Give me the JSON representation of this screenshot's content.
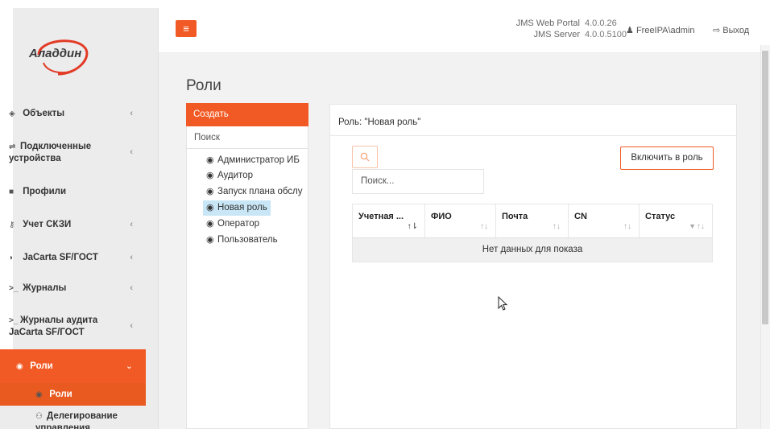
{
  "brand": {
    "logo_text": "Аладдин"
  },
  "topbar": {
    "portal_label": "JMS Web Portal",
    "portal_version": "4.0.0.26",
    "server_label": "JMS Server",
    "server_version": "4.0.0.5100",
    "user": "FreeIPA\\admin",
    "logout": "Выход"
  },
  "sidebar": {
    "items": [
      {
        "label": "Объекты",
        "icon": "diamond-icon"
      },
      {
        "label_line1": "Подключенные",
        "label_line2": "устройства",
        "icon": "usb-icon"
      },
      {
        "label": "Профили",
        "icon": "folder-icon"
      },
      {
        "label": "Учет СКЗИ",
        "icon": "key-icon"
      },
      {
        "label": "JaCarta SF/ГОСТ",
        "icon": "shield-icon"
      },
      {
        "label": "Журналы",
        "icon": "terminal-icon"
      },
      {
        "label_line1": "Журналы аудита",
        "label_line2": "JaCarta SF/ГОСТ",
        "icon": "terminal-icon"
      },
      {
        "label": "Роли",
        "icon": "user-circle-icon"
      },
      {
        "label": "Роли",
        "icon": "user-circle-icon"
      },
      {
        "label_line1": "Делегирование",
        "label_line2": "управления",
        "icon": "users-plus-icon"
      }
    ]
  },
  "page": {
    "title": "Роли"
  },
  "roles": {
    "create_label": "Создать",
    "search_label": "Поиск",
    "items": [
      "Администратор ИБ",
      "Аудитор",
      "Запуск плана обслу",
      "Новая роль",
      "Оператор",
      "Пользователь"
    ],
    "selected": "Новая роль"
  },
  "main": {
    "header": "Роль: \"Новая роль\"",
    "include_button": "Включить в роль",
    "search_placeholder": "Поиск...",
    "columns": [
      "Учетная ...",
      "ФИО",
      "Почта",
      "CN",
      "Статус"
    ],
    "empty_text": "Нет данных для показа"
  },
  "colors": {
    "accent": "#f15a24",
    "selected": "#c9e6f6"
  }
}
